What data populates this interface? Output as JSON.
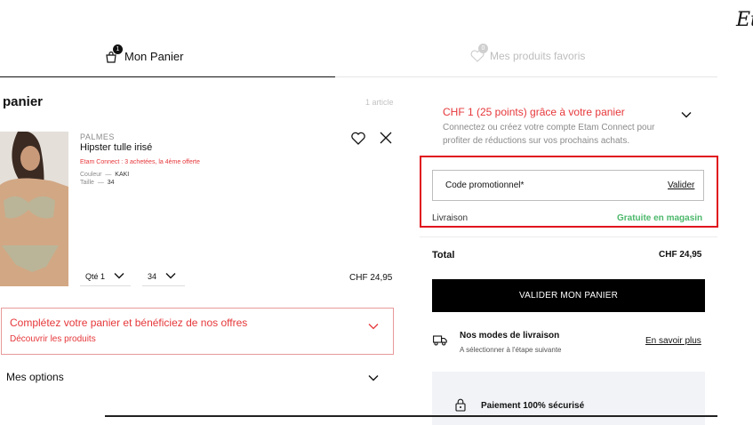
{
  "brand_logo": "Et",
  "tabs": {
    "cart": {
      "label": "Mon Panier",
      "badge": "1"
    },
    "favorites": {
      "label": "Mes produits favoris",
      "badge": "0"
    }
  },
  "cart": {
    "title": "panier",
    "count": "1 article",
    "item": {
      "brand": "PALMES",
      "name": "Hipster tulle irisé",
      "promo": "Etam Connect : 3 achetées, la 4ème offerte",
      "color_label": "Couleur",
      "color_value": "KAKI",
      "size_label": "Taille",
      "size_value": "34",
      "qty_label": "Qté 1",
      "size_select": "34",
      "price": "CHF 24,95"
    },
    "offer": {
      "title": "Complétez votre panier et bénéficiez de nos offres",
      "link": "Découvrir les produits"
    },
    "options_label": "Mes options"
  },
  "summary": {
    "loyalty_title": "CHF 1 (25 points) grâce à votre panier",
    "loyalty_desc": "Connectez ou créez votre compte Etam Connect pour profiter de réductions sur vos prochains achats.",
    "promo_placeholder": "Code promotionnel*",
    "promo_validate": "Valider",
    "shipping_label": "Livraison",
    "shipping_value": "Gratuite en magasin",
    "total_label": "Total",
    "total_value": "CHF 24,95",
    "cta_label": "VALIDER MON PANIER",
    "delivery_title": "Nos modes de livraison",
    "delivery_sub": "A sélectionner à l'étape suivante",
    "learn_more": "En savoir plus",
    "secure_title": "Paiement 100% sécurisé"
  },
  "colors": {
    "accent_red": "#e6373a",
    "highlight_red": "#e0141d",
    "success_green": "#4cb86b"
  },
  "icons": [
    "bag-icon",
    "heart-icon",
    "close-icon",
    "chevron-down-icon",
    "truck-icon",
    "lock-icon"
  ]
}
